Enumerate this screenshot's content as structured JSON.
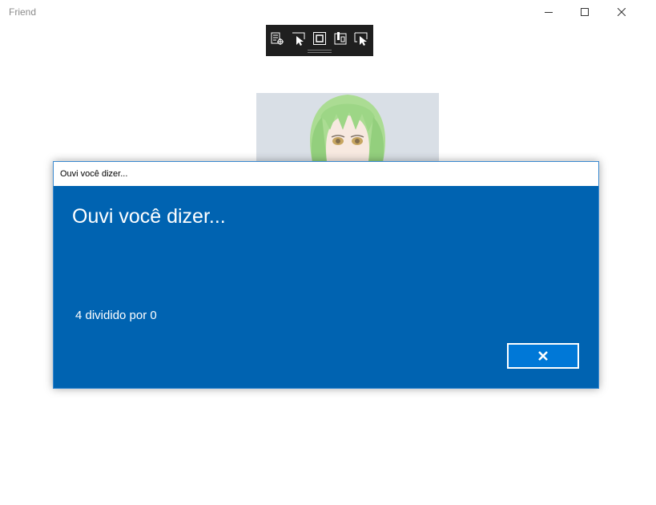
{
  "window": {
    "title": "Friend"
  },
  "dialog": {
    "titlebar_text": "Ouvi você dizer...",
    "heading": "Ouvi você dizer...",
    "body": "4 dividido por 0",
    "close_icon": "close-icon"
  },
  "debug_toolbar": {
    "icons": [
      "live-visual-tree-icon",
      "select-element-icon",
      "display-layout-adorners-icon",
      "track-focus-icon",
      "hot-reload-icon"
    ]
  },
  "colors": {
    "dialog_background": "#0063b1",
    "dialog_button": "#0078d7",
    "toolbar_background": "#1f1f1f"
  }
}
